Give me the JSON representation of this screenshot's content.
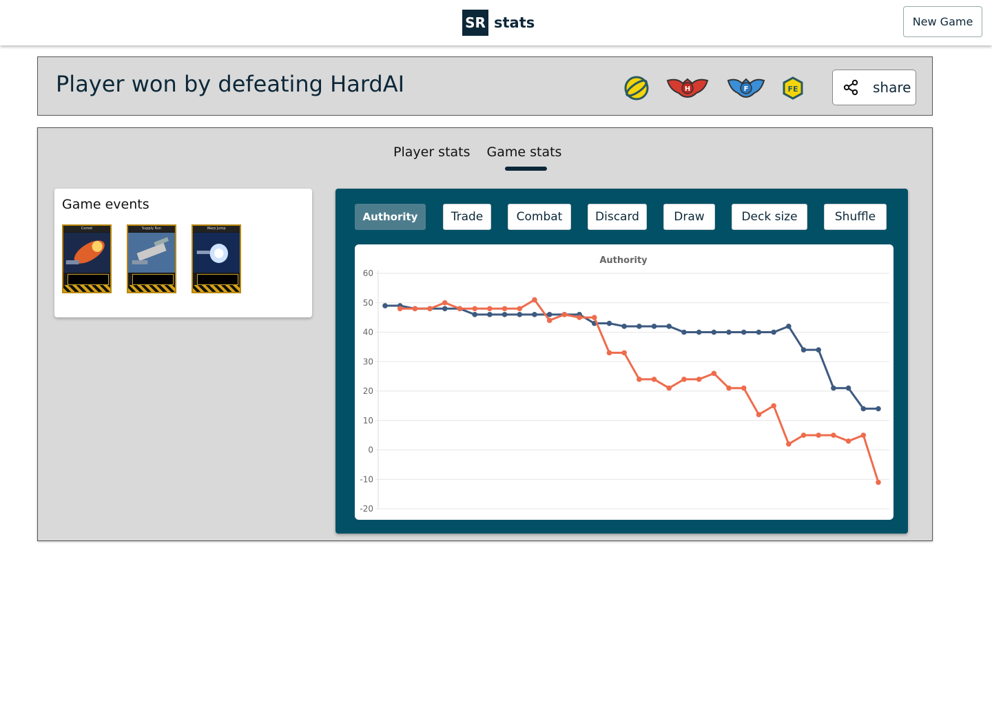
{
  "header": {
    "brand_mark": "SR",
    "brand_text": "stats",
    "new_game_label": "New Game"
  },
  "result": {
    "title": "Player won by defeating HardAI",
    "share_label": "share",
    "faction_icons": [
      "trade-federation-icon",
      "blob-icon",
      "star-empire-icon",
      "machine-cult-icon"
    ]
  },
  "tabs": [
    {
      "label": "Player stats",
      "active": false
    },
    {
      "label": "Game stats",
      "active": true
    }
  ],
  "events": {
    "title": "Game events",
    "cards": [
      {
        "name": "Comet"
      },
      {
        "name": "Supply Run"
      },
      {
        "name": "Warp Jump"
      }
    ]
  },
  "stat_buttons": [
    {
      "label": "Authority",
      "active": true
    },
    {
      "label": "Trade",
      "active": false
    },
    {
      "label": "Combat",
      "active": false
    },
    {
      "label": "Discard",
      "active": false
    },
    {
      "label": "Draw",
      "active": false
    },
    {
      "label": "Deck size",
      "active": false
    },
    {
      "label": "Shuffle",
      "active": false
    }
  ],
  "colors": {
    "brand_dark": "#0c2738",
    "panel_teal": "#025066",
    "active_button": "#4d7d8d",
    "series_blue": "#3d5a80",
    "series_orange": "#ee6c4d"
  },
  "chart_data": {
    "type": "line",
    "title": "Authority",
    "xlabel": "",
    "ylabel": "",
    "ylim": [
      -20,
      60
    ],
    "yticks": [
      60,
      50,
      40,
      30,
      20,
      10,
      0,
      -10,
      -20
    ],
    "grid": true,
    "series": [
      {
        "color": "#3d5a80",
        "x": [
          0,
          1,
          2,
          3,
          4,
          5,
          6,
          7,
          8,
          9,
          10,
          11,
          12,
          13,
          14,
          15,
          16,
          17,
          18,
          19,
          20,
          21,
          22,
          23,
          24,
          25,
          26,
          27,
          28,
          29,
          30,
          31,
          32,
          33
        ],
        "values": [
          49,
          49,
          48,
          48,
          48,
          48,
          46,
          46,
          46,
          46,
          46,
          46,
          46,
          46,
          43,
          43,
          42,
          42,
          42,
          42,
          40,
          40,
          40,
          40,
          40,
          40,
          40,
          42,
          34,
          34,
          21,
          21,
          14,
          14
        ]
      },
      {
        "color": "#ee6c4d",
        "x": [
          1,
          2,
          3,
          4,
          5,
          6,
          7,
          8,
          9,
          10,
          11,
          12,
          13,
          14,
          15,
          16,
          17,
          18,
          19,
          20,
          21,
          22,
          23,
          24,
          25,
          26,
          27,
          28,
          29,
          30,
          31,
          32,
          33
        ],
        "values": [
          48,
          48,
          48,
          50,
          48,
          48,
          48,
          48,
          48,
          51,
          44,
          46,
          45,
          45,
          33,
          33,
          24,
          24,
          21,
          24,
          24,
          26,
          21,
          21,
          12,
          15,
          2,
          5,
          5,
          5,
          3,
          5,
          -11
        ]
      }
    ]
  }
}
